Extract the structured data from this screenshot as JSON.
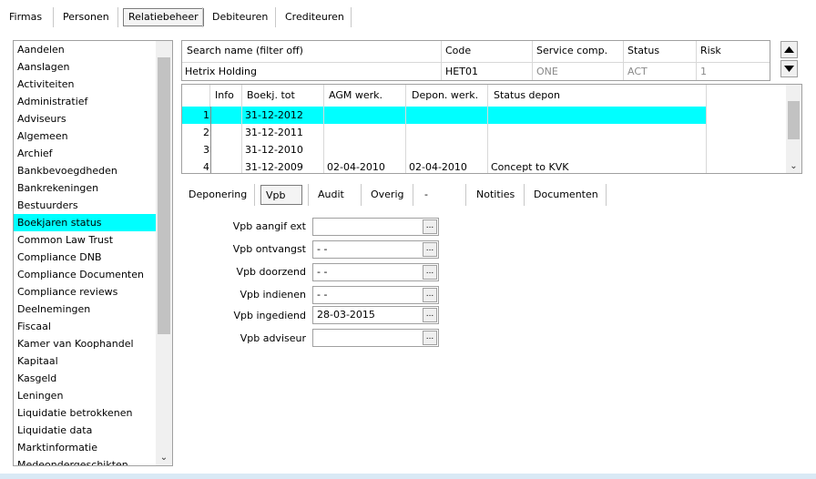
{
  "top_tabs": [
    "Firmas",
    "Personen",
    "Relatiebeheer",
    "Debiteuren",
    "Crediteuren"
  ],
  "left_list": {
    "items": [
      "Aandelen",
      "Aanslagen",
      "Activiteiten",
      "Administratief",
      "Adviseurs",
      "Algemeen",
      "Archief",
      "Bankbevoegdheden",
      "Bankrekeningen",
      "Bestuurders",
      "Boekjaren status",
      "Common Law Trust",
      "Compliance DNB",
      "Compliance Documenten",
      "Compliance reviews",
      "Deelnemingen",
      "Fiscaal",
      "Kamer van Koophandel",
      "Kapitaal",
      "Kasgeld",
      "Leningen",
      "Liquidatie betrokkenen",
      "Liquidatie data",
      "Marktinformatie",
      "Medeondergeschikten"
    ],
    "selected": "Boekjaren status"
  },
  "header_grid": {
    "columns": [
      "Search name (filter off)",
      "Code",
      "Service comp.",
      "Status",
      "Risk"
    ],
    "row": [
      "Hetrix Holding",
      "HET01",
      "ONE",
      "ACT",
      "1"
    ]
  },
  "detail_grid": {
    "columns": [
      "Info",
      "Boekj. tot",
      "AGM werk.",
      "Depon. werk.",
      "Status depon"
    ],
    "rows": [
      {
        "num": "1",
        "info": "",
        "boekj": "31-12-2012",
        "agm": "",
        "depon": "",
        "status": ""
      },
      {
        "num": "2",
        "info": "",
        "boekj": "31-12-2011",
        "agm": "",
        "depon": "",
        "status": ""
      },
      {
        "num": "3",
        "info": "",
        "boekj": "31-12-2010",
        "agm": "",
        "depon": "",
        "status": ""
      },
      {
        "num": "4",
        "info": "",
        "boekj": "31-12-2009",
        "agm": "02-04-2010",
        "depon": "02-04-2010",
        "status": "Concept to KVK"
      }
    ]
  },
  "sub_tabs": [
    "Deponering",
    "Vpb",
    "Audit",
    "Overig",
    "-",
    "Notities",
    "Documenten"
  ],
  "form": {
    "fields": [
      {
        "label": "Vpb aangif ext",
        "value": ""
      },
      {
        "label": "Vpb ontvangst",
        "value": " -  -"
      },
      {
        "label": "Vpb doorzend",
        "value": " -  -"
      },
      {
        "label": "Vpb indienen",
        "value": " -  -"
      },
      {
        "label": "Vpb ingediend",
        "value": "28-03-2015"
      },
      {
        "label": "Vpb adviseur",
        "value": ""
      }
    ],
    "button_label": "..."
  },
  "icons": {
    "scroll_down": "chevron-down-icon",
    "nav_up": "triangle-up-icon",
    "nav_down": "triangle-down-icon"
  },
  "colors": {
    "selection": "#00ffff"
  }
}
